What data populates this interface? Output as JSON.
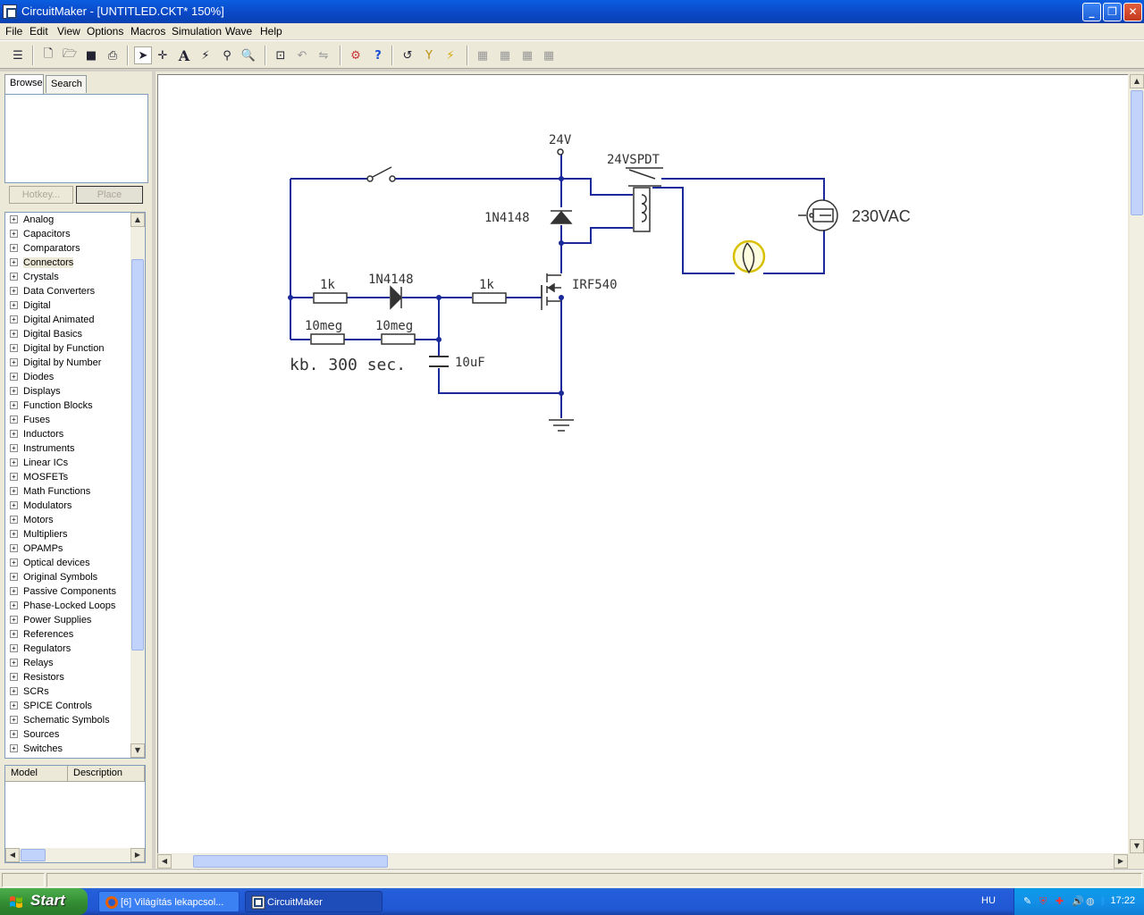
{
  "window": {
    "title": "CircuitMaker - [UNTITLED.CKT* 150%]",
    "app_icon": "circuitmaker-icon",
    "controls": [
      "minimize-icon",
      "restore-icon",
      "close-icon"
    ]
  },
  "menu": {
    "items": [
      "File",
      "Edit",
      "View",
      "Options",
      "Macros",
      "Simulation",
      "Wave",
      "Help"
    ]
  },
  "toolbar": {
    "icons": [
      "toggle-panel-icon",
      "new-file-icon",
      "open-file-icon",
      "save-icon",
      "print-icon",
      "arrow-tool-icon",
      "wire-tool-icon",
      "text-tool-icon",
      "probe-tool-icon",
      "delete-tool-icon",
      "zoom-tool-icon",
      "zoom-fit-icon",
      "rotate-icon",
      "mirror-icon",
      "digital-simulation-icon",
      "help-icon",
      "reset-icon",
      "trace-icon",
      "run-icon",
      "macro-1-icon",
      "macro-2-icon",
      "macro-3-icon",
      "macro-4-icon"
    ]
  },
  "leftpanel": {
    "tabs": [
      "Browse",
      "Search"
    ],
    "hotkey_label": "Hotkey...",
    "place_label": "Place",
    "categories": [
      "Analog",
      "Capacitors",
      "Comparators",
      "Connectors",
      "Crystals",
      "Data Converters",
      "Digital",
      "Digital Animated",
      "Digital Basics",
      "Digital by Function",
      "Digital by Number",
      "Diodes",
      "Displays",
      "Function Blocks",
      "Fuses",
      "Inductors",
      "Instruments",
      "Linear ICs",
      "MOSFETs",
      "Math Functions",
      "Modulators",
      "Motors",
      "Multipliers",
      "OPAMPs",
      "Optical devices",
      "Original Symbols",
      "Passive Components",
      "Phase-Locked Loops",
      "Power Supplies",
      "References",
      "Regulators",
      "Relays",
      "Resistors",
      "SCRs",
      "SPICE Controls",
      "Schematic Symbols",
      "Sources",
      "Switches"
    ],
    "selected_category": "Connectors",
    "model_headers": [
      "Model",
      "Description"
    ]
  },
  "schematic": {
    "labels": {
      "supply": "24V",
      "relay": "24VSPDT",
      "diode_top": "1N4148",
      "diode_mid": "1N4148",
      "r1": "1k",
      "r2": "1k",
      "r3": "10meg",
      "r4": "10meg",
      "mosfet": "IRF540",
      "capacitor": "10uF",
      "ac_source": "230VAC",
      "note": "kb. 300 sec."
    },
    "wire_color": "#1a2a9a",
    "component_color": "#333333"
  },
  "taskbar": {
    "start_label": "Start",
    "tasks": [
      {
        "label": "[6] Világítás lekapcsol...",
        "icon": "firefox-icon"
      },
      {
        "label": "CircuitMaker",
        "icon": "circuitmaker-icon"
      }
    ],
    "language": "HU",
    "clock": "17:22"
  }
}
